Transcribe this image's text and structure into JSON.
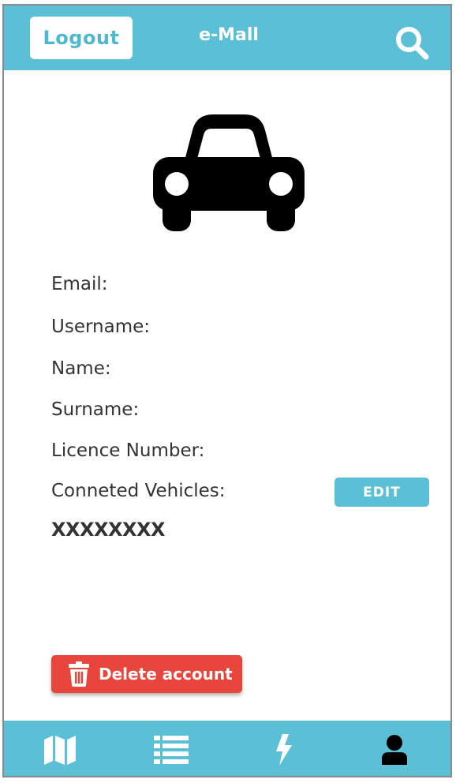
{
  "header": {
    "logout_label": "Logout",
    "title": "e-Mall",
    "search_icon": "search-icon"
  },
  "profile": {
    "icon": "car-icon",
    "fields": [
      {
        "label": "Email:"
      },
      {
        "label": "Username:"
      },
      {
        "label": "Name:"
      },
      {
        "label": "Surname:"
      },
      {
        "label": "Licence Number:"
      },
      {
        "label": "Conneted Vehicles:"
      }
    ],
    "edit_label": "EDIT",
    "vehicle_value": "XXXXXXXX"
  },
  "actions": {
    "delete_label": "Delete account"
  },
  "bottom_nav": {
    "items": [
      {
        "icon": "map-icon"
      },
      {
        "icon": "list-icon"
      },
      {
        "icon": "lightning-icon"
      },
      {
        "icon": "user-icon",
        "active": true
      }
    ]
  },
  "colors": {
    "primary": "#5bc0d6",
    "danger": "#e8453c",
    "text": "#333333",
    "active_icon": "#000000",
    "inactive_icon": "#ffffff"
  }
}
